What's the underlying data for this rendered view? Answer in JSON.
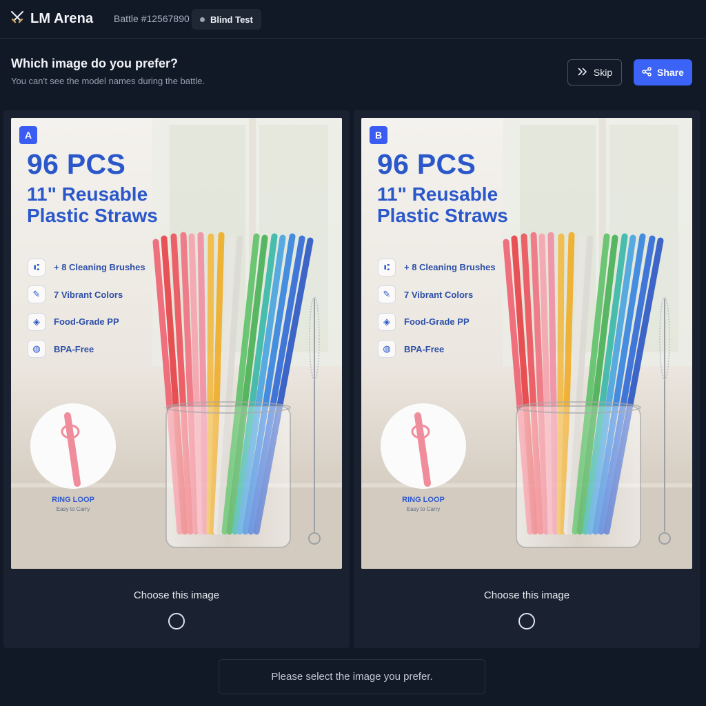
{
  "app": {
    "title": "LM Arena",
    "logo_icon": "crossed-swords-icon",
    "battle_id": "Battle #12567890",
    "mode_chip": "Blind Test"
  },
  "prompt": {
    "title": "Which image do you prefer?",
    "subtitle": "You can't see the model names during the battle."
  },
  "actions": {
    "skip_label": "Skip",
    "share_label": "Share"
  },
  "panels": [
    {
      "badge": "A",
      "choose_label": "Choose this image",
      "image": {
        "headline": "96 PCS",
        "subline": "11\" Reusable Plastic Straws",
        "features": [
          {
            "icon": "brush-icon",
            "text": "+ 8 Cleaning Brushes"
          },
          {
            "icon": "palette-icon",
            "text": "7 Vibrant Colors"
          },
          {
            "icon": "shield-icon",
            "text": "Food-Grade PP"
          },
          {
            "icon": "bottle-icon",
            "text": "BPA-Free"
          }
        ],
        "loop_title": "RING LOOP",
        "loop_sub": "Easy to Carry"
      }
    },
    {
      "badge": "B",
      "choose_label": "Choose this image",
      "image": {
        "headline": "96 PCS",
        "subline": "11\" Reusable Plastic Straws",
        "features": [
          {
            "icon": "brush-icon",
            "text": "+ 8 Cleaning Brushes"
          },
          {
            "icon": "palette-icon",
            "text": "7 Vibrant Colors"
          },
          {
            "icon": "shield-icon",
            "text": "Food-Grade PP"
          },
          {
            "icon": "bottle-icon",
            "text": "BPA-Free"
          }
        ],
        "loop_title": "RING LOOP",
        "loop_sub": "Easy to Carry"
      }
    }
  ],
  "status_message": "Please select the image you prefer.",
  "colors": {
    "background": "#111826",
    "panel": "#1a2231",
    "accent": "#3b63f5",
    "headline_blue": "#2a57c9"
  }
}
